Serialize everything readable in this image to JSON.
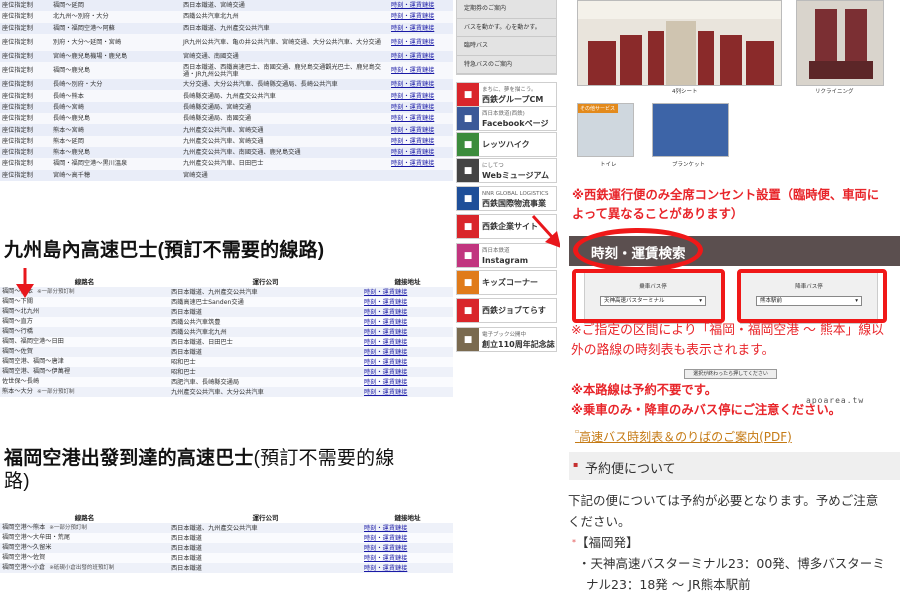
{
  "left": {
    "top_table": [
      {
        "type": "座位指定制",
        "route": "福岡～延岡",
        "operator": "西日本鐵道、宮崎交通",
        "link": "時刻・運賃鏈接"
      },
      {
        "type": "座位指定制",
        "route": "北九州～別府・大分",
        "operator": "西鐵公共汽車北九州",
        "link": "時刻・運賃鏈接"
      },
      {
        "type": "座位指定制",
        "route": "福岡・福岡空港～阿蘇",
        "operator": "西日本鐵道、九州產交公共汽車",
        "link": "時刻・運賃鏈接"
      },
      {
        "type": "座位指定制",
        "route": "別府・大分～延岡・宮崎",
        "operator": "JR九州公共汽車、亀の井公共汽車、宮崎交通、大分公共汽車、大分交通",
        "link": "時刻・運賃鏈接",
        "tall": true
      },
      {
        "type": "座位指定制",
        "route": "宮崎～鹿兒島機場・鹿兒島",
        "operator": "宮崎交通、南國交通",
        "link": "時刻・運賃鏈接"
      },
      {
        "type": "座位指定制",
        "route": "福岡～鹿兒島",
        "operator": "西日本鐵道、西鐵高速巴士、南國交通、鹿兒島交通觀光巴士、鹿兒島交通・JR九州公共汽車",
        "link": "時刻・運賃鏈接",
        "tall": true
      },
      {
        "type": "座位指定制",
        "route": "長崎～別府・大分",
        "operator": "大分交通、大分公共汽車、長崎縣交通局、長崎公共汽車",
        "link": "時刻・運賃鏈接"
      },
      {
        "type": "座位指定制",
        "route": "長崎～熊本",
        "operator": "長崎縣交通局、九州產交公共汽車",
        "link": "時刻・運賃鏈接"
      },
      {
        "type": "座位指定制",
        "route": "長崎～宮崎",
        "operator": "長崎縣交通局、宮崎交通",
        "link": "時刻・運賃鏈接"
      },
      {
        "type": "座位指定制",
        "route": "長崎～鹿兒島",
        "operator": "長崎縣交通局、南國交通",
        "link": "時刻・運賃鏈接"
      },
      {
        "type": "座位指定制",
        "route": "熊本～宮崎",
        "operator": "九州產交公共汽車、宮崎交通",
        "link": "時刻・運賃鏈接"
      },
      {
        "type": "座位指定制",
        "route": "熊本～延岡",
        "operator": "九州產交公共汽車、宮崎交通",
        "link": "時刻・運賃鏈接"
      },
      {
        "type": "座位指定制",
        "route": "熊本～鹿兒島",
        "operator": "九州產交公共汽車、南國交通、鹿兒島交通",
        "link": "時刻・運賃鏈接"
      },
      {
        "type": "座位指定制",
        "route": "福岡・福岡空港～黒川溫泉",
        "operator": "九州產交公共汽車、日田巴士",
        "link": "時刻・運賃鏈接"
      },
      {
        "type": "座位指定制",
        "route": "宮崎～高千穂",
        "operator": "宮崎交通",
        "link": ""
      }
    ],
    "section1_title": "九州島內高速巴士(預訂不需要的線路)",
    "headers": {
      "route": "線路名",
      "operator": "運行公司",
      "link": "鏈接地址"
    },
    "mid_table": [
      {
        "route": "福岡～熊本",
        "note": "※一部分預訂制",
        "operator": "西日本鐵道、九州產交公共汽車",
        "link": "時刻・運賃鏈接"
      },
      {
        "route": "福岡～下關",
        "note": "",
        "operator": "西鐵高速巴士Sanden交通",
        "link": "時刻・運賃鏈接"
      },
      {
        "route": "福岡～北九州",
        "note": "",
        "operator": "西日本鐵道",
        "link": "時刻・運賃鏈接"
      },
      {
        "route": "福岡～直方",
        "note": "",
        "operator": "西鐵公共汽車筑豊",
        "link": "時刻・運賃鏈接"
      },
      {
        "route": "福岡～行橋",
        "note": "",
        "operator": "西鐵公共汽車北九州",
        "link": "時刻・運賃鏈接"
      },
      {
        "route": "福岡、福岡空港～日田",
        "note": "",
        "operator": "西日本鐵道、日田巴士",
        "link": "時刻・運賃鏈接"
      },
      {
        "route": "福岡～佐賀",
        "note": "",
        "operator": "西日本鐵道",
        "link": "時刻・運賃鏈接"
      },
      {
        "route": "福岡空港、福岡～唐津",
        "note": "",
        "operator": "昭和巴士",
        "link": "時刻・運賃鏈接"
      },
      {
        "route": "福岡空港、福岡～伊萬裡",
        "note": "",
        "operator": "昭和巴士",
        "link": "時刻・運賃鏈接"
      },
      {
        "route": "佐世保～長崎",
        "note": "",
        "operator": "西肥汽車、長崎縣交通局",
        "link": "時刻・運賃鏈接"
      },
      {
        "route": "熊本～大分",
        "note": "※一部分預訂制",
        "operator": "九州產交公共汽車、大分公共汽車",
        "link": "時刻・運賃鏈接"
      }
    ],
    "section2_title_bold": "福岡空港出發到達的高速巴士",
    "section2_title_normal": "(預訂不需要的線",
    "section2_title_line2": "路)",
    "bot_table": [
      {
        "route": "福岡空港～熊本",
        "note": "※一部分預訂制",
        "operator": "西日本鐵道、九州產交公共汽車",
        "link": "時刻・運賃鏈接"
      },
      {
        "route": "福岡空港～大牟田・荒尾",
        "note": "",
        "operator": "西日本鐵道",
        "link": "時刻・運賃鏈接"
      },
      {
        "route": "福岡空港～久留米",
        "note": "",
        "operator": "西日本鐵道",
        "link": "時刻・運賃鏈接"
      },
      {
        "route": "福岡空港～佐賀",
        "note": "",
        "operator": "西日本鐵道",
        "link": "時刻・運賃鏈接"
      },
      {
        "route": "福岡空港～小倉",
        "note": "※砥硯小倉出發的班預訂制",
        "operator": "西日本鐵道",
        "link": "時刻・運賃鏈接"
      }
    ]
  },
  "mid": {
    "menu": [
      "定期券のご案内",
      "バスを動かす。心を動かす。",
      "臨時バス",
      "特急バスのご案内"
    ],
    "banners": [
      {
        "title": "西鉄グループCM",
        "sub": "まちに、夢を描こう。",
        "color": "#d9262b"
      },
      {
        "title": "Facebookページ",
        "sub": "西日本鉄道(西鉄)",
        "color": "#3b5998"
      },
      {
        "title": "レッツハイク",
        "sub": "",
        "color": "#3c8c3c"
      },
      {
        "title": "Webミュージアム",
        "sub": "にしてつ",
        "color": "#444444"
      },
      {
        "title": "西鉄国際物流事業",
        "sub": "NNR GLOBAL LOGISTICS",
        "color": "#1f4f99"
      },
      {
        "title": "西鉄企業サイト",
        "sub": "",
        "color": "#d9262b"
      },
      {
        "title": "Instagram",
        "sub": "西日本鉄道",
        "color": "#c1357f"
      },
      {
        "title": "キッズコーナー",
        "sub": "",
        "color": "#e07b1a"
      },
      {
        "title": "西鉄ジョブてらす",
        "sub": "",
        "color": "#d9262b"
      },
      {
        "title": "創立110周年記念誌",
        "sub": "電子ブック公開中",
        "color": "#7a6a4f"
      }
    ]
  },
  "right": {
    "cap_4row": "4列シート",
    "cap_recline": "リクライニング",
    "cap_toilet": "トイレ",
    "cap_blanket": "ブランケット",
    "badge": "その他サービス",
    "notice_line1": "※西鉄運行便のみ全席コンセント設置（臨時便、車両に",
    "notice_line2": "よって異なることがあります）",
    "search_label": "時刻・運賃検索",
    "board_label": "乗車バス停",
    "board_value": "天神高速バスターミナル",
    "alight_label": "降車バス停",
    "alight_value": "熊本駅前",
    "range_note1": "※ご指定の区間により「福岡・福岡空港 ～ 熊本」線以",
    "range_note2": "外の路線の時刻表も表示されます。",
    "submit_label": "選択が終わったら押してください",
    "noreserve": "※本路線は予約不要です。",
    "ride_only": "※乗車のみ・降車のみバス停にご注意ください。",
    "pdf_link": "高速バス時刻表＆のりばのご案内(PDF)",
    "section_h": "予約便について",
    "body1": "下記の便については予約が必要となります。予めご注意",
    "body2": "ください。",
    "fukuoka": "【福岡発】",
    "item1a": "・天神高速バスターミナル23：00発、博多バスターミ",
    "item1b": "ナル23：18発 ～ JR熊本駅前",
    "watermark": "apoarea.tw"
  }
}
